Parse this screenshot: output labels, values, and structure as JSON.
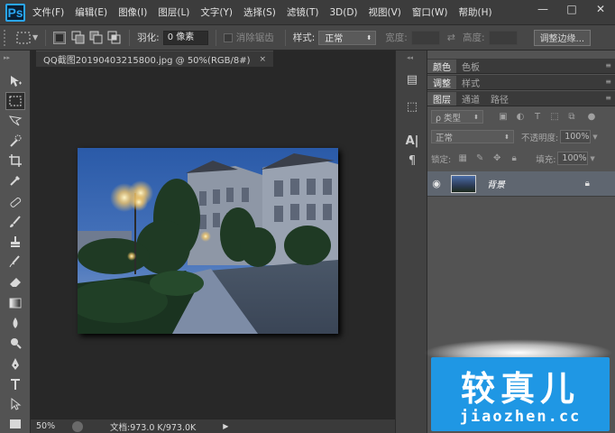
{
  "app": {
    "logo": "Ps"
  },
  "menu": [
    "文件(F)",
    "编辑(E)",
    "图像(I)",
    "图层(L)",
    "文字(Y)",
    "选择(S)",
    "滤镜(T)",
    "3D(D)",
    "视图(V)",
    "窗口(W)",
    "帮助(H)"
  ],
  "window_controls": {
    "minimize": "—",
    "restore": "□",
    "close": "✕"
  },
  "options": {
    "feather_label": "羽化:",
    "feather_value": "0 像素",
    "antialias_label": "消除锯齿",
    "style_label": "样式:",
    "style_value": "正常",
    "width_label": "宽度:",
    "height_label": "高度:",
    "refine_edge": "调整边缘..."
  },
  "document": {
    "tab_title": "QQ截图20190403215800.jpg @ 50%(RGB/8#)",
    "tab_close": "×",
    "zoom": "50%",
    "doc_info": "文档:973.0 K/973.0K"
  },
  "panels": {
    "group1_tabs": [
      "颜色",
      "色板"
    ],
    "group2_tabs": [
      "调整",
      "样式"
    ],
    "group3_tabs": [
      "图层",
      "通道",
      "路径"
    ],
    "filter_kind": "ρ 类型",
    "blend_mode": "正常",
    "opacity_label": "不透明度:",
    "opacity_value": "100%",
    "lock_label": "锁定:",
    "fill_label": "填充:",
    "fill_value": "100%",
    "layer_name": "背景"
  },
  "watermark": {
    "line1": "较真儿",
    "line2": "jiaozhen.cc"
  },
  "colors": {
    "accent": "#1f97e4",
    "ps_blue": "#2aa6f2",
    "layer_selected": "#5f6670"
  }
}
